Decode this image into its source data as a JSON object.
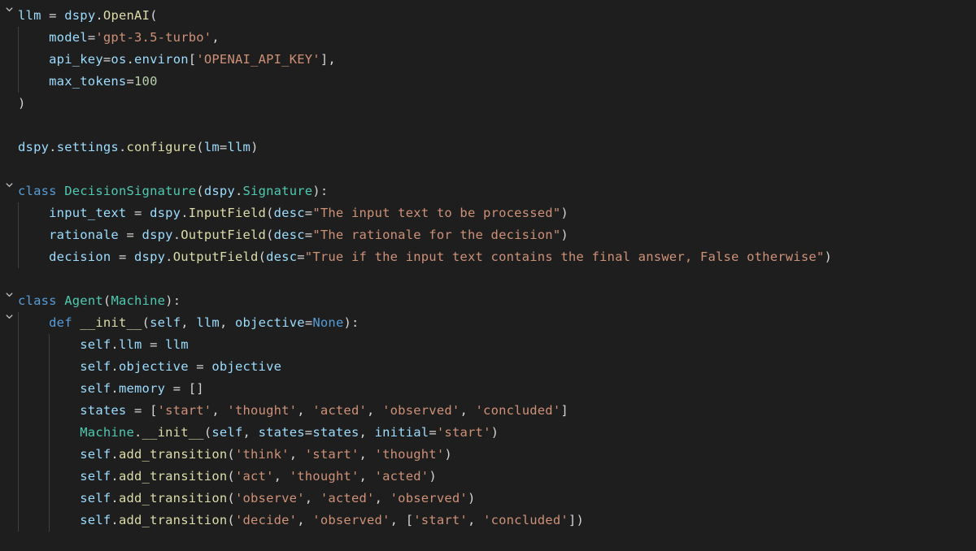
{
  "editor": {
    "language": "python",
    "theme": "dark",
    "fold_icon": "chevron-down",
    "indent_guides": true
  },
  "code": {
    "lines": [
      {
        "fold": true,
        "indent": 0,
        "tokens": [
          [
            "var",
            "llm"
          ],
          [
            "op",
            " = "
          ],
          [
            "var",
            "dspy"
          ],
          [
            "op",
            "."
          ],
          [
            "fn",
            "OpenAI"
          ],
          [
            "op",
            "("
          ]
        ]
      },
      {
        "fold": false,
        "indent": 1,
        "tokens": [
          [
            "var",
            "model"
          ],
          [
            "op",
            "="
          ],
          [
            "str",
            "'gpt-3.5-turbo'"
          ],
          [
            "op",
            ","
          ]
        ]
      },
      {
        "fold": false,
        "indent": 1,
        "tokens": [
          [
            "var",
            "api_key"
          ],
          [
            "op",
            "="
          ],
          [
            "var",
            "os"
          ],
          [
            "op",
            "."
          ],
          [
            "var",
            "environ"
          ],
          [
            "op",
            "["
          ],
          [
            "str",
            "'OPENAI_API_KEY'"
          ],
          [
            "op",
            "],"
          ]
        ]
      },
      {
        "fold": false,
        "indent": 1,
        "tokens": [
          [
            "var",
            "max_tokens"
          ],
          [
            "op",
            "="
          ],
          [
            "num",
            "100"
          ]
        ]
      },
      {
        "fold": false,
        "indent": 0,
        "tokens": [
          [
            "op",
            ")"
          ]
        ]
      },
      {
        "fold": false,
        "indent": 0,
        "tokens": []
      },
      {
        "fold": false,
        "indent": 0,
        "tokens": [
          [
            "var",
            "dspy"
          ],
          [
            "op",
            "."
          ],
          [
            "var",
            "settings"
          ],
          [
            "op",
            "."
          ],
          [
            "fn",
            "configure"
          ],
          [
            "op",
            "("
          ],
          [
            "var",
            "lm"
          ],
          [
            "op",
            "="
          ],
          [
            "var",
            "llm"
          ],
          [
            "op",
            ")"
          ]
        ]
      },
      {
        "fold": false,
        "indent": 0,
        "tokens": []
      },
      {
        "fold": true,
        "indent": 0,
        "tokens": [
          [
            "kw",
            "class"
          ],
          [
            "plain",
            " "
          ],
          [
            "cls",
            "DecisionSignature"
          ],
          [
            "op",
            "("
          ],
          [
            "var",
            "dspy"
          ],
          [
            "op",
            "."
          ],
          [
            "cls",
            "Signature"
          ],
          [
            "op",
            "):"
          ]
        ]
      },
      {
        "fold": false,
        "indent": 1,
        "tokens": [
          [
            "var",
            "input_text"
          ],
          [
            "op",
            " = "
          ],
          [
            "var",
            "dspy"
          ],
          [
            "op",
            "."
          ],
          [
            "fn",
            "InputField"
          ],
          [
            "op",
            "("
          ],
          [
            "var",
            "desc"
          ],
          [
            "op",
            "="
          ],
          [
            "str",
            "\"The input text to be processed\""
          ],
          [
            "op",
            ")"
          ]
        ]
      },
      {
        "fold": false,
        "indent": 1,
        "tokens": [
          [
            "var",
            "rationale"
          ],
          [
            "op",
            " = "
          ],
          [
            "var",
            "dspy"
          ],
          [
            "op",
            "."
          ],
          [
            "fn",
            "OutputField"
          ],
          [
            "op",
            "("
          ],
          [
            "var",
            "desc"
          ],
          [
            "op",
            "="
          ],
          [
            "str",
            "\"The rationale for the decision\""
          ],
          [
            "op",
            ")"
          ]
        ]
      },
      {
        "fold": false,
        "indent": 1,
        "tokens": [
          [
            "var",
            "decision"
          ],
          [
            "op",
            " = "
          ],
          [
            "var",
            "dspy"
          ],
          [
            "op",
            "."
          ],
          [
            "fn",
            "OutputField"
          ],
          [
            "op",
            "("
          ],
          [
            "var",
            "desc"
          ],
          [
            "op",
            "="
          ],
          [
            "str",
            "\"True if the input text contains the final answer, False otherwise\""
          ],
          [
            "op",
            ")"
          ]
        ]
      },
      {
        "fold": false,
        "indent": 0,
        "tokens": []
      },
      {
        "fold": true,
        "indent": 0,
        "tokens": [
          [
            "kw",
            "class"
          ],
          [
            "plain",
            " "
          ],
          [
            "cls",
            "Agent"
          ],
          [
            "op",
            "("
          ],
          [
            "cls",
            "Machine"
          ],
          [
            "op",
            "):"
          ]
        ]
      },
      {
        "fold": true,
        "indent": 1,
        "tokens": [
          [
            "kw",
            "def"
          ],
          [
            "plain",
            " "
          ],
          [
            "fn",
            "__init__"
          ],
          [
            "op",
            "("
          ],
          [
            "var",
            "self"
          ],
          [
            "op",
            ", "
          ],
          [
            "var",
            "llm"
          ],
          [
            "op",
            ", "
          ],
          [
            "var",
            "objective"
          ],
          [
            "op",
            "="
          ],
          [
            "const",
            "None"
          ],
          [
            "op",
            "):"
          ]
        ]
      },
      {
        "fold": false,
        "indent": 2,
        "tokens": [
          [
            "self",
            "self"
          ],
          [
            "op",
            "."
          ],
          [
            "prop",
            "llm"
          ],
          [
            "op",
            " = "
          ],
          [
            "var",
            "llm"
          ]
        ]
      },
      {
        "fold": false,
        "indent": 2,
        "tokens": [
          [
            "self",
            "self"
          ],
          [
            "op",
            "."
          ],
          [
            "prop",
            "objective"
          ],
          [
            "op",
            " = "
          ],
          [
            "var",
            "objective"
          ]
        ]
      },
      {
        "fold": false,
        "indent": 2,
        "tokens": [
          [
            "self",
            "self"
          ],
          [
            "op",
            "."
          ],
          [
            "prop",
            "memory"
          ],
          [
            "op",
            " = []"
          ]
        ]
      },
      {
        "fold": false,
        "indent": 2,
        "tokens": [
          [
            "var",
            "states"
          ],
          [
            "op",
            " = ["
          ],
          [
            "str",
            "'start'"
          ],
          [
            "op",
            ", "
          ],
          [
            "str",
            "'thought'"
          ],
          [
            "op",
            ", "
          ],
          [
            "str",
            "'acted'"
          ],
          [
            "op",
            ", "
          ],
          [
            "str",
            "'observed'"
          ],
          [
            "op",
            ", "
          ],
          [
            "str",
            "'concluded'"
          ],
          [
            "op",
            "]"
          ]
        ]
      },
      {
        "fold": false,
        "indent": 2,
        "tokens": [
          [
            "cls",
            "Machine"
          ],
          [
            "op",
            "."
          ],
          [
            "fn",
            "__init__"
          ],
          [
            "op",
            "("
          ],
          [
            "var",
            "self"
          ],
          [
            "op",
            ", "
          ],
          [
            "var",
            "states"
          ],
          [
            "op",
            "="
          ],
          [
            "var",
            "states"
          ],
          [
            "op",
            ", "
          ],
          [
            "var",
            "initial"
          ],
          [
            "op",
            "="
          ],
          [
            "str",
            "'start'"
          ],
          [
            "op",
            ")"
          ]
        ]
      },
      {
        "fold": false,
        "indent": 2,
        "tokens": [
          [
            "self",
            "self"
          ],
          [
            "op",
            "."
          ],
          [
            "fn",
            "add_transition"
          ],
          [
            "op",
            "("
          ],
          [
            "str",
            "'think'"
          ],
          [
            "op",
            ", "
          ],
          [
            "str",
            "'start'"
          ],
          [
            "op",
            ", "
          ],
          [
            "str",
            "'thought'"
          ],
          [
            "op",
            ")"
          ]
        ]
      },
      {
        "fold": false,
        "indent": 2,
        "tokens": [
          [
            "self",
            "self"
          ],
          [
            "op",
            "."
          ],
          [
            "fn",
            "add_transition"
          ],
          [
            "op",
            "("
          ],
          [
            "str",
            "'act'"
          ],
          [
            "op",
            ", "
          ],
          [
            "str",
            "'thought'"
          ],
          [
            "op",
            ", "
          ],
          [
            "str",
            "'acted'"
          ],
          [
            "op",
            ")"
          ]
        ]
      },
      {
        "fold": false,
        "indent": 2,
        "tokens": [
          [
            "self",
            "self"
          ],
          [
            "op",
            "."
          ],
          [
            "fn",
            "add_transition"
          ],
          [
            "op",
            "("
          ],
          [
            "str",
            "'observe'"
          ],
          [
            "op",
            ", "
          ],
          [
            "str",
            "'acted'"
          ],
          [
            "op",
            ", "
          ],
          [
            "str",
            "'observed'"
          ],
          [
            "op",
            ")"
          ]
        ]
      },
      {
        "fold": false,
        "indent": 2,
        "tokens": [
          [
            "self",
            "self"
          ],
          [
            "op",
            "."
          ],
          [
            "fn",
            "add_transition"
          ],
          [
            "op",
            "("
          ],
          [
            "str",
            "'decide'"
          ],
          [
            "op",
            ", "
          ],
          [
            "str",
            "'observed'"
          ],
          [
            "op",
            ", ["
          ],
          [
            "str",
            "'start'"
          ],
          [
            "op",
            ", "
          ],
          [
            "str",
            "'concluded'"
          ],
          [
            "op",
            "])"
          ]
        ]
      }
    ]
  }
}
